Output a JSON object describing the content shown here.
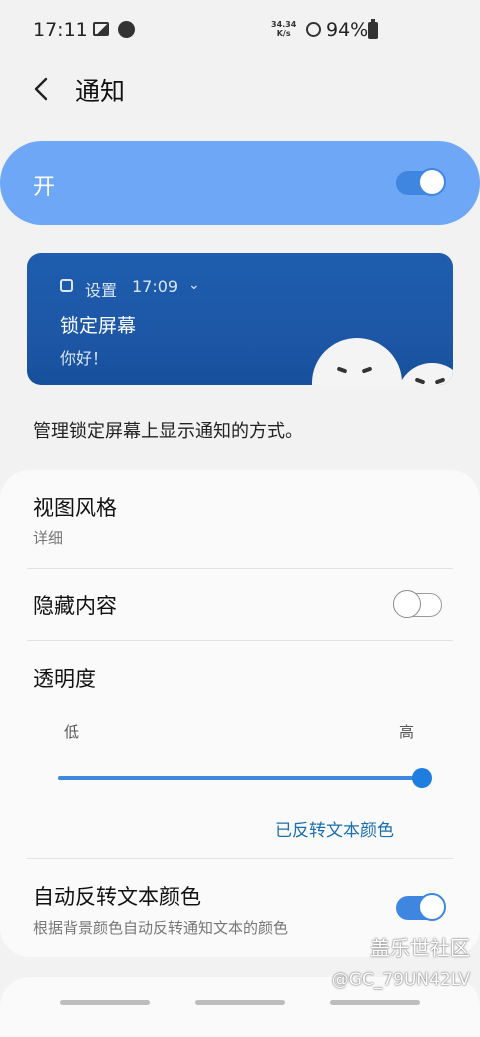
{
  "status_bar": {
    "time": "17:11",
    "net_speed_value": "34.34",
    "net_speed_unit": "K/s",
    "battery": "94%"
  },
  "header": {
    "title": "通知"
  },
  "master": {
    "label": "开",
    "enabled": true
  },
  "preview": {
    "app_name": "设置",
    "time": "17:09",
    "title": "锁定屏幕",
    "body": "你好！"
  },
  "description": "管理锁定屏幕上显示通知的方式。",
  "settings": {
    "view_style": {
      "title": "视图风格",
      "value": "详细"
    },
    "hide_content": {
      "title": "隐藏内容",
      "enabled": false
    },
    "transparency": {
      "title": "透明度",
      "low": "低",
      "high": "高",
      "level": 1.0
    },
    "inverted_link": "已反转文本颜色",
    "auto_invert": {
      "title": "自动反转文本颜色",
      "subtitle": "根据背景颜色自动反转通知文本的颜色",
      "enabled": true
    }
  },
  "watermark": {
    "line1": "盖乐世社区",
    "line2": "@GC_79UN42LV"
  },
  "colors": {
    "accent": "#3e86e0",
    "master_bg": "#6ea7f5",
    "link": "#1a6fae"
  }
}
